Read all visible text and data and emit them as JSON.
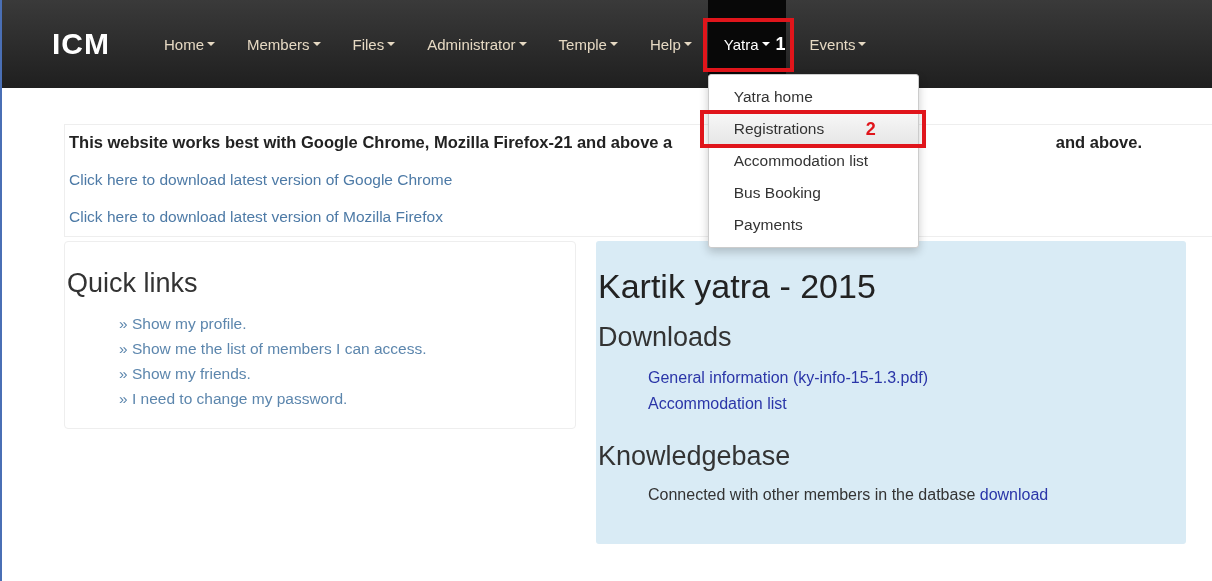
{
  "navbar": {
    "brand": "ICM",
    "items": [
      {
        "label": "Home",
        "selected": false
      },
      {
        "label": "Members",
        "selected": false
      },
      {
        "label": "Files",
        "selected": false
      },
      {
        "label": "Administrator",
        "selected": false
      },
      {
        "label": "Temple",
        "selected": false
      },
      {
        "label": "Help",
        "selected": false
      },
      {
        "label": "Yatra",
        "selected": true,
        "annotation": "1",
        "dropdown": [
          {
            "label": "Yatra home",
            "selected": false
          },
          {
            "label": "Registrations",
            "selected": true,
            "annotation": "2"
          },
          {
            "label": "Accommodation list",
            "selected": false
          },
          {
            "label": "Bus Booking",
            "selected": false
          },
          {
            "label": "Payments",
            "selected": false
          }
        ]
      },
      {
        "label": "Events",
        "selected": false
      }
    ]
  },
  "browser_notice": {
    "message_start": "This website works best with Google Chrome, Mozilla Firefox-21 and above a",
    "message_end": "and above.",
    "links": [
      "Click here to download latest version of Google Chrome",
      "Click here to download latest version of Mozilla Firefox"
    ]
  },
  "quick_links": {
    "title": "Quick links",
    "items": [
      "» Show my profile.",
      "» Show me the list of members I can access.",
      "» Show my friends.",
      "» I need to change my password."
    ]
  },
  "yatra_panel": {
    "title": "Kartik yatra - 2015",
    "sections": [
      {
        "heading": "Downloads",
        "links": [
          "General information (ky-info-15-1.3.pdf)",
          "Accommodation list"
        ]
      },
      {
        "heading": "Knowledgebase",
        "text": "Connected with other members in the datbase",
        "link": "download"
      }
    ]
  }
}
